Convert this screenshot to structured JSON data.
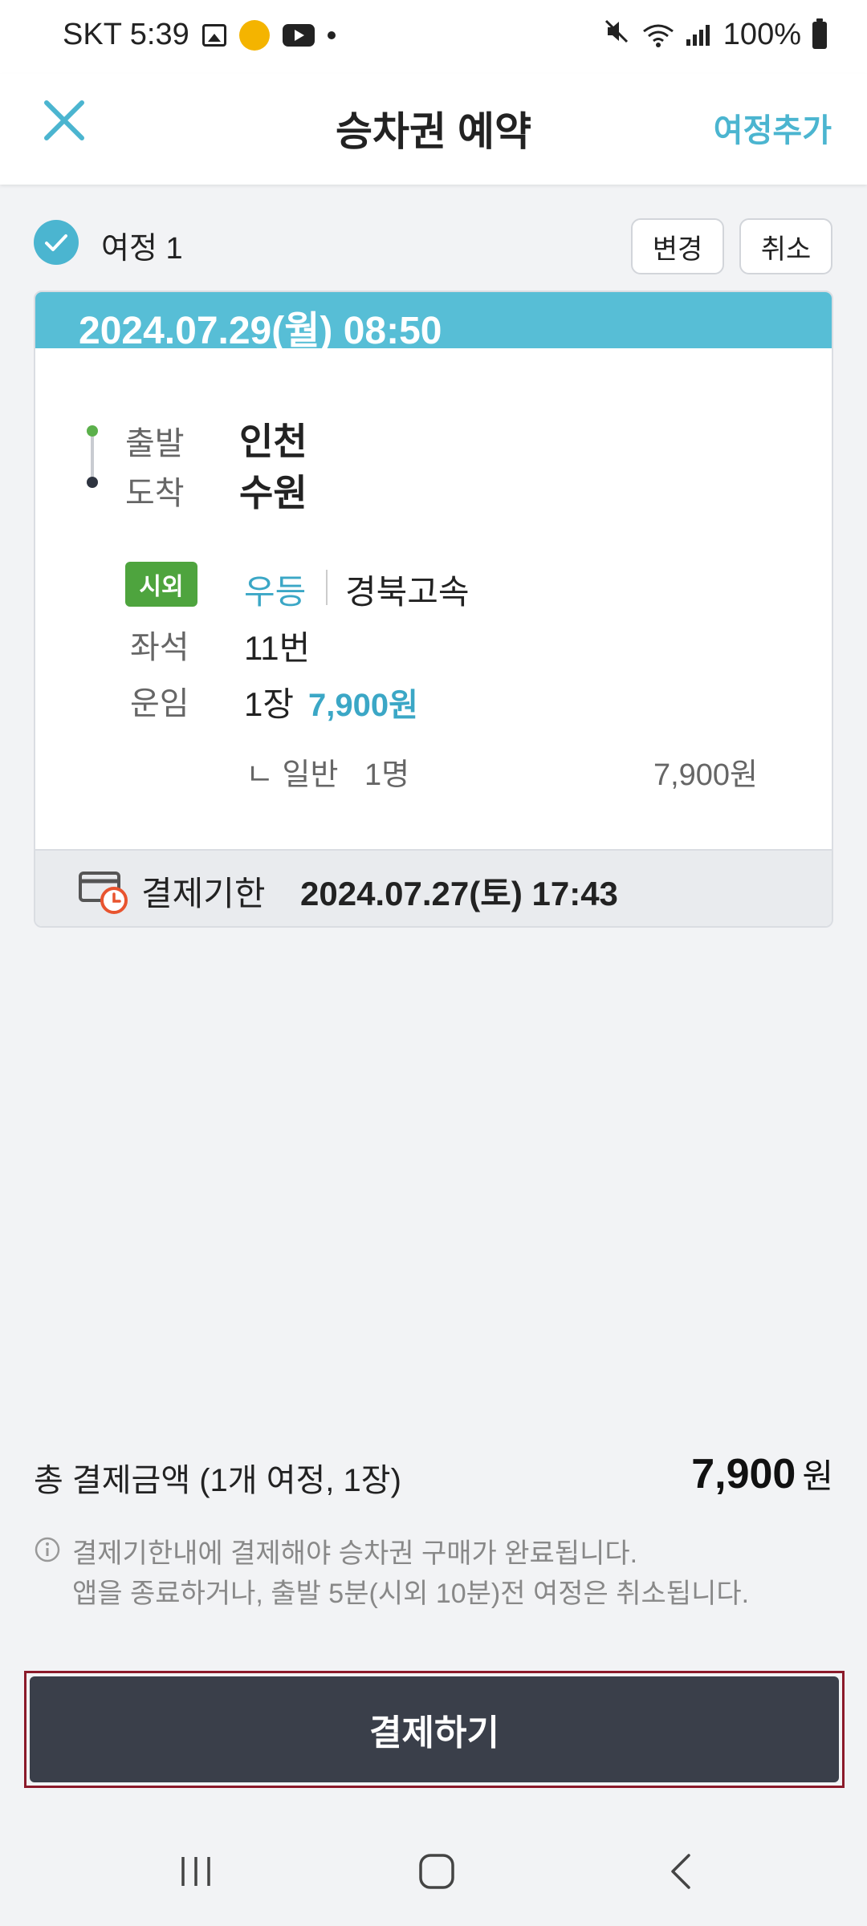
{
  "status_bar": {
    "carrier_time": "SKT 5:39",
    "battery": "100%",
    "icons": [
      "gallery-icon",
      "app-icon",
      "youtube-icon",
      "dot-icon",
      "mute-icon",
      "wifi-icon",
      "signal-icon",
      "battery-icon"
    ]
  },
  "header": {
    "title": "승차권 예약",
    "add_trip_label": "여정추가",
    "close_icon": "close-icon"
  },
  "trip": {
    "label": "여정 1",
    "change_label": "변경",
    "cancel_label": "취소",
    "date_time": "2024.07.29(월) 08:50",
    "depart_label": "출발",
    "depart_value": "인천",
    "arrive_label": "도착",
    "arrive_value": "수원",
    "badge": "시외",
    "bus_class": "우등",
    "bus_company": "경북고속",
    "seat_label": "좌석",
    "seat_value": "11번",
    "fare_label": "운임",
    "fare_count": "1장",
    "fare_amount": "7,900원",
    "detail_type": "ㄴ 일반",
    "detail_count": "1명",
    "detail_amount": "7,900원",
    "deadline_label": "결제기한",
    "deadline_value": "2024.07.27(토) 17:43"
  },
  "summary": {
    "total_label": "총 결제금액 (1개 여정, 1장)",
    "total_amount": "7,900",
    "total_unit": "원",
    "notice_line1": "결제기한내에 결제해야 승차권 구매가 완료됩니다.",
    "notice_line2": "앱을 종료하거나, 출발 5분(시외 10분)전 여정은 취소됩니다."
  },
  "actions": {
    "pay_label": "결제하기"
  },
  "colors": {
    "accent": "#4BB5D0",
    "card_header": "#57BED6",
    "badge_green": "#4EA43E",
    "pay_button": "#3A3F4A",
    "highlight_border": "#8B1A2A"
  }
}
